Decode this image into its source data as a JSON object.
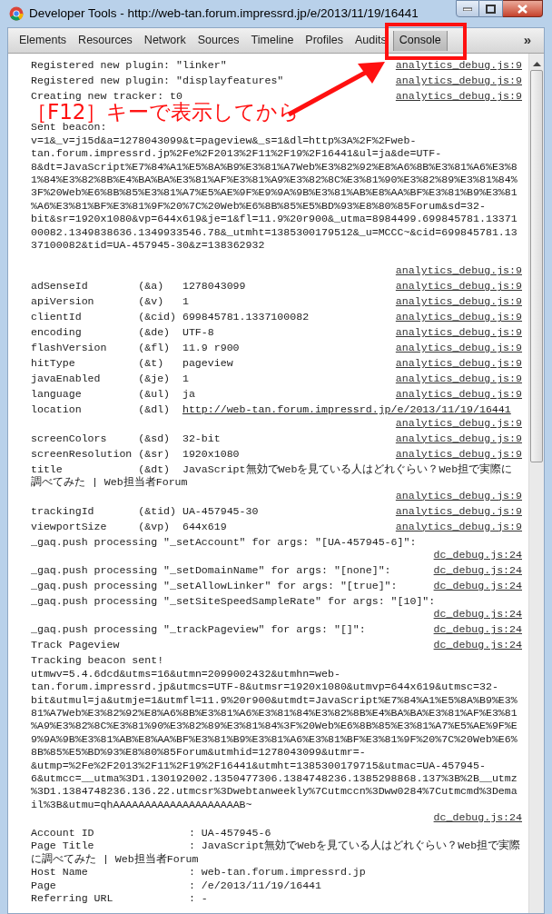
{
  "window": {
    "title": "Developer Tools - http://web-tan.forum.impressrd.jp/e/2013/11/19/16441"
  },
  "tabs": [
    {
      "label": "Elements",
      "selected": false
    },
    {
      "label": "Resources",
      "selected": false
    },
    {
      "label": "Network",
      "selected": false
    },
    {
      "label": "Sources",
      "selected": false
    },
    {
      "label": "Timeline",
      "selected": false
    },
    {
      "label": "Profiles",
      "selected": false
    },
    {
      "label": "Audits",
      "selected": false
    },
    {
      "label": "Console",
      "selected": true
    }
  ],
  "overflow_button": "»",
  "console": [
    {
      "kind": "log",
      "text": "Registered new plugin: \"linker\"",
      "source": "analytics_debug.js:9"
    },
    {
      "kind": "log",
      "text": "Registered new plugin: \"displayfeatures\"",
      "source": "analytics_debug.js:9"
    },
    {
      "kind": "log",
      "text": "Creating new tracker: t0",
      "source": "analytics_debug.js:9"
    },
    {
      "kind": "annotation",
      "text": "［F12］キーで表示してから"
    },
    {
      "kind": "detached",
      "text": "Sent beacon:\nv=1&_v=j15d&a=1278043099&t=pageview&_s=1&dl=http%3A%2F%2Fweb-tan.forum.impressrd.jp%2Fe%2F2013%2F11%2F19%2F16441&ul=ja&de=UTF-8&dt=JavaScript%E7%84%A1%E5%8A%B9%E3%81%A7Web%E3%82%92%E8%A6%8B%E3%81%A6%E3%81%84%E3%82%8B%E4%BA%BA%E3%81%AF%E3%81%A9%E3%82%8C%E3%81%90%E3%82%89%E3%81%84%3F%20Web%E6%8B%85%E3%81%A7%E5%AE%9F%E9%9A%9B%E3%81%AB%E8%AA%BF%E3%81%B9%E3%81%A6%E3%81%BF%E3%81%9F%20%7C%20Web%E6%8B%85%E5%BD%93%E8%80%85Forum&sd=32-bit&sr=1920x1080&vp=644x619&je=1&fl=11.9%20r900&_utma=8984499.699845781.1337100082.1349838636.1349933546.78&_utmht=1385300179512&_u=MCCC~&cid=699845781.1337100082&tid=UA-457945-30&z=138362932",
      "source": "analytics_debug.js:9"
    },
    {
      "kind": "field",
      "name": "adSenseId",
      "param": "(&a)",
      "value": "1278043099",
      "source": "analytics_debug.js:9"
    },
    {
      "kind": "field",
      "name": "apiVersion",
      "param": "(&v)",
      "value": "1",
      "source": "analytics_debug.js:9"
    },
    {
      "kind": "field",
      "name": "clientId",
      "param": "(&cid)",
      "value": "699845781.1337100082",
      "source": "analytics_debug.js:9"
    },
    {
      "kind": "field",
      "name": "encoding",
      "param": "(&de)",
      "value": "UTF-8",
      "source": "analytics_debug.js:9"
    },
    {
      "kind": "field",
      "name": "flashVersion",
      "param": "(&fl)",
      "value": "11.9 r900",
      "source": "analytics_debug.js:9"
    },
    {
      "kind": "field",
      "name": "hitType",
      "param": "(&t)",
      "value": "pageview",
      "source": "analytics_debug.js:9"
    },
    {
      "kind": "field",
      "name": "javaEnabled",
      "param": "(&je)",
      "value": "1",
      "source": "analytics_debug.js:9"
    },
    {
      "kind": "field",
      "name": "language",
      "param": "(&ul)",
      "value": "ja",
      "source": "analytics_debug.js:9"
    },
    {
      "kind": "field_link",
      "name": "location",
      "param": "(&dl)",
      "value": "http://web-tan.forum.impressrd.jp/e/2013/11/19/16441",
      "source": "analytics_debug.js:9"
    },
    {
      "kind": "field",
      "name": "screenColors",
      "param": "(&sd)",
      "value": "32-bit",
      "source": "analytics_debug.js:9"
    },
    {
      "kind": "field",
      "name": "screenResolution",
      "param": "(&sr)",
      "value": "1920x1080",
      "source": "analytics_debug.js:9"
    },
    {
      "kind": "field",
      "name": "title",
      "param": "(&dt)",
      "value": "JavaScript無効でWebを見ている人はどれぐらい？Web担で実際に調べてみた | Web担当者Forum",
      "source": "analytics_debug.js:9"
    },
    {
      "kind": "field",
      "name": "trackingId",
      "param": "(&tid)",
      "value": "UA-457945-30",
      "source": "analytics_debug.js:9"
    },
    {
      "kind": "field",
      "name": "viewportSize",
      "param": "(&vp)",
      "value": "644x619",
      "source": "analytics_debug.js:9"
    },
    {
      "kind": "log",
      "text": "_gaq.push processing \"_setAccount\" for args: \"[UA-457945-6]\":",
      "source": "dc_debug.js:24"
    },
    {
      "kind": "log",
      "text": "_gaq.push processing \"_setDomainName\" for args: \"[none]\":",
      "source": "dc_debug.js:24"
    },
    {
      "kind": "log",
      "text": "_gaq.push processing \"_setAllowLinker\" for args: \"[true]\":",
      "source": "dc_debug.js:24"
    },
    {
      "kind": "log",
      "text": "_gaq.push processing \"_setSiteSpeedSampleRate\" for args: \"[10]\":",
      "source": "dc_debug.js:24"
    },
    {
      "kind": "log",
      "text": "_gaq.push processing \"_trackPageview\" for args: \"[]\":",
      "source": "dc_debug.js:24"
    },
    {
      "kind": "log",
      "text": "Track Pageview",
      "source": "dc_debug.js:24"
    },
    {
      "kind": "log",
      "text": "Tracking beacon sent!\nutmwv=5.4.6dcd&utms=16&utmn=2099002432&utmhn=web-tan.forum.impressrd.jp&utmcs=UTF-8&utmsr=1920x1080&utmvp=644x619&utmsc=32-bit&utmul=ja&utmje=1&utmfl=11.9%20r900&utmdt=JavaScript%E7%84%A1%E5%8A%B9%E3%81%A7Web%E3%82%92%E8%A6%8B%E3%81%A6%E3%81%84%E3%82%8B%E4%BA%BA%E3%81%AF%E3%81%A9%E3%82%8C%E3%81%90%E3%82%89%E3%81%84%3F%20Web%E6%8B%85%E3%81%A7%E5%AE%9F%E9%9A%9B%E3%81%AB%E8%AA%BF%E3%81%B9%E3%81%A6%E3%81%BF%E3%81%9F%20%7C%20Web%E6%8B%85%E5%BD%93%E8%80%85Forum&utmhid=1278043099&utmr=-&utmp=%2Fe%2F2013%2F11%2F19%2F16441&utmht=1385300179715&utmac=UA-457945-6&utmcc=__utma%3D1.130192002.1350477306.1384748236.1385298868.137%3B%2B__utmz%3D1.1384748236.136.22.utmcsr%3Dwebtanweekly%7Cutmccn%3Dww0284%7Cutmcmd%3Demail%3B&utmu=qhAAAAAAAAAAAAAAAAAAAAB~",
      "source": "dc_debug.js:24"
    },
    {
      "kind": "table",
      "lines": [
        "Account ID               : UA-457945-6",
        "Page Title               : JavaScript無効でWebを見ている人はどれぐらい？Web担で実際に調べてみた | Web担当者Forum",
        "Host Name                : web-tan.forum.impressrd.jp",
        "Page                     : /e/2013/11/19/16441",
        "Referring URL            : -"
      ]
    }
  ]
}
